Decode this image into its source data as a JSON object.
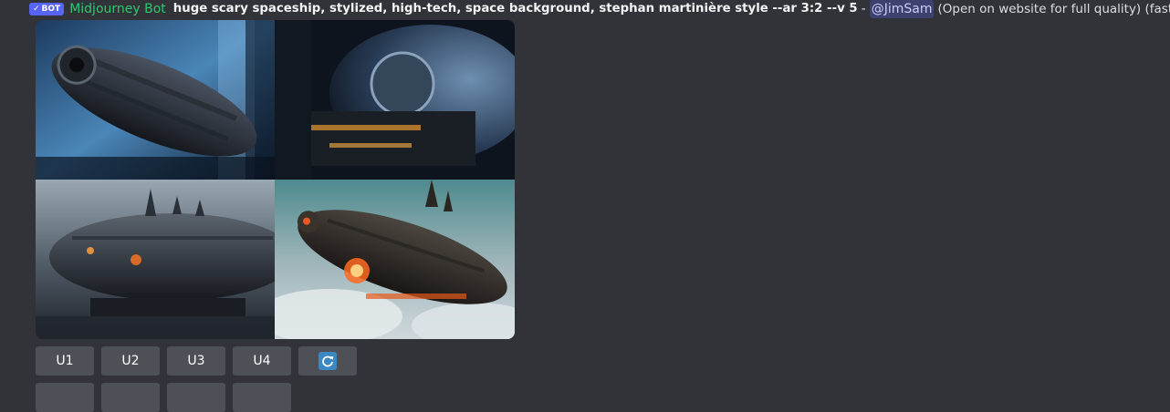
{
  "message": {
    "bot_badge": "BOT",
    "author": "Midjourney Bot",
    "prompt": "huge scary spaceship, stylized, high-tech, space background, stephan martinière style --ar 3:2 --v 5",
    "separator": "-",
    "mention": "@JimSam",
    "suffix": "(Open on website for full quality) (fast)"
  },
  "buttons": {
    "upscale": [
      {
        "label": "U1"
      },
      {
        "label": "U2"
      },
      {
        "label": "U3"
      },
      {
        "label": "U4"
      }
    ],
    "reroll_icon": "refresh-icon"
  },
  "colors": {
    "background": "#313338",
    "author": "#2dc770",
    "bot_badge": "#5865f2",
    "button": "#4e5058",
    "reroll": "#3b88c3"
  }
}
